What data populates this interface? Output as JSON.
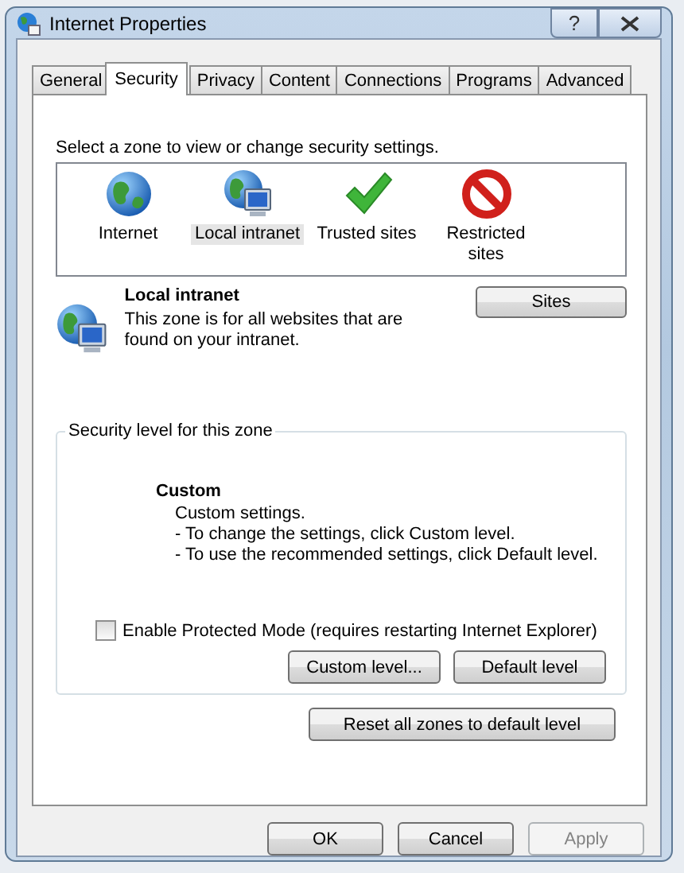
{
  "window": {
    "title": "Internet Properties",
    "help": "?"
  },
  "tabs": [
    {
      "label": "General",
      "selected": false
    },
    {
      "label": "Security",
      "selected": true
    },
    {
      "label": "Privacy",
      "selected": false
    },
    {
      "label": "Content",
      "selected": false
    },
    {
      "label": "Connections",
      "selected": false
    },
    {
      "label": "Programs",
      "selected": false
    },
    {
      "label": "Advanced",
      "selected": false
    }
  ],
  "zone_prompt": "Select a zone to view or change security settings.",
  "zones": [
    {
      "label": "Internet",
      "kind": "globe",
      "selected": false
    },
    {
      "label": "Local intranet",
      "kind": "intranet",
      "selected": true
    },
    {
      "label": "Trusted sites",
      "kind": "check",
      "selected": false
    },
    {
      "label": "Restricted sites",
      "kind": "blocked",
      "selected": false
    }
  ],
  "zone_info": {
    "kind": "intranet",
    "title": "Local intranet",
    "description": "This zone is for all websites that are found on your intranet.",
    "sites_button": "Sites"
  },
  "security_level": {
    "legend": "Security level for this zone",
    "name": "Custom",
    "lines": [
      "Custom settings.",
      "- To change the settings, click Custom level.",
      "- To use the recommended settings, click Default level."
    ],
    "protected_mode": {
      "label": "Enable Protected Mode (requires restarting Internet Explorer)",
      "checked": false
    },
    "buttons": [
      "Custom level...",
      "Default level"
    ]
  },
  "reset_button": "Reset all zones to default level",
  "footer_buttons": [
    {
      "label": "OK",
      "disabled": false
    },
    {
      "label": "Cancel",
      "disabled": false
    },
    {
      "label": "Apply",
      "disabled": true
    }
  ]
}
